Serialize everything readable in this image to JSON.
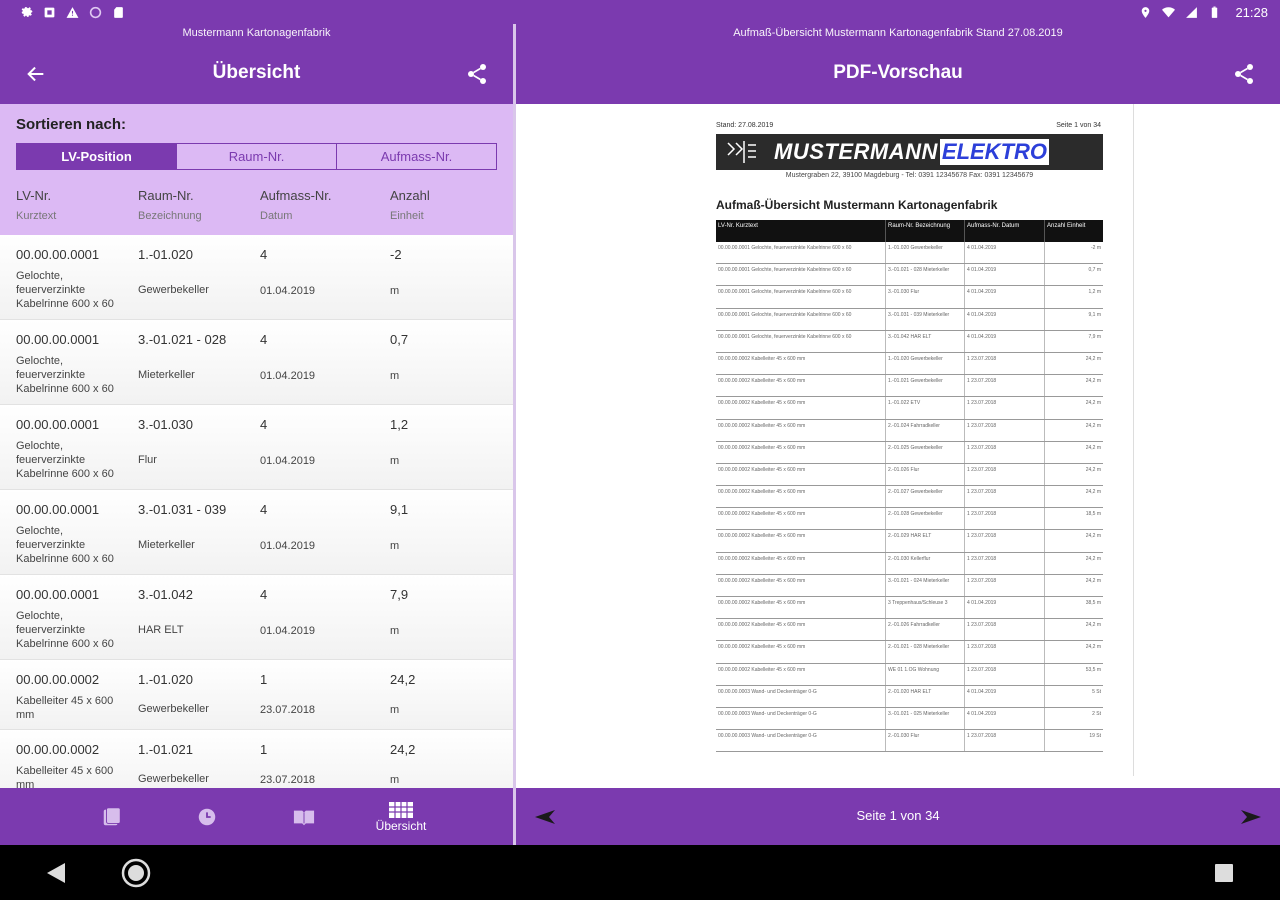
{
  "status_bar": {
    "time": "21:28",
    "left_icons": [
      "gear-icon",
      "app-icon",
      "warning-icon",
      "circle-icon",
      "sd-card-icon"
    ],
    "right_icons": [
      "location-icon",
      "wifi-icon",
      "signal-icon",
      "battery-icon"
    ]
  },
  "left_pane": {
    "subtitle": "Mustermann Kartonagenfabrik",
    "title": "Übersicht",
    "sort": {
      "label": "Sortieren nach:",
      "options": [
        {
          "label": "LV-Position",
          "active": true
        },
        {
          "label": "Raum-Nr.",
          "active": false
        },
        {
          "label": "Aufmass-Nr.",
          "active": false
        }
      ]
    },
    "columns": {
      "c1_main": "LV-Nr.",
      "c1_sub": "Kurztext",
      "c2_main": "Raum-Nr.",
      "c2_sub": "Bezeichnung",
      "c3_main": "Aufmass-Nr.",
      "c3_sub": "Datum",
      "c4_main": "Anzahl",
      "c4_sub": "Einheit"
    },
    "rows": [
      {
        "lv": "00.00.00.0001",
        "text": [
          "Gelochte,",
          "feuerverzinkte",
          "Kabelrinne 600 x 60"
        ],
        "raum": "1.-01.020",
        "bez": "Gewerbekeller",
        "aufmass": "4",
        "datum": "01.04.2019",
        "anzahl": "-2",
        "einheit": "m"
      },
      {
        "lv": "00.00.00.0001",
        "text": [
          "Gelochte,",
          "feuerverzinkte",
          "Kabelrinne 600 x 60"
        ],
        "raum": "3.-01.021 - 028",
        "bez": "Mieterkeller",
        "aufmass": "4",
        "datum": "01.04.2019",
        "anzahl": "0,7",
        "einheit": "m"
      },
      {
        "lv": "00.00.00.0001",
        "text": [
          "Gelochte,",
          "feuerverzinkte",
          "Kabelrinne 600 x 60"
        ],
        "raum": "3.-01.030",
        "bez": "Flur",
        "aufmass": "4",
        "datum": "01.04.2019",
        "anzahl": "1,2",
        "einheit": "m"
      },
      {
        "lv": "00.00.00.0001",
        "text": [
          "Gelochte,",
          "feuerverzinkte",
          "Kabelrinne 600 x 60"
        ],
        "raum": "3.-01.031 - 039",
        "bez": "Mieterkeller",
        "aufmass": "4",
        "datum": "01.04.2019",
        "anzahl": "9,1",
        "einheit": "m"
      },
      {
        "lv": "00.00.00.0001",
        "text": [
          "Gelochte,",
          "feuerverzinkte",
          "Kabelrinne 600 x 60"
        ],
        "raum": "3.-01.042",
        "bez": "HAR ELT",
        "aufmass": "4",
        "datum": "01.04.2019",
        "anzahl": "7,9",
        "einheit": "m"
      },
      {
        "lv": "00.00.00.0002",
        "text": [
          "Kabelleiter 45 x 600",
          "mm"
        ],
        "raum": "1.-01.020",
        "bez": "Gewerbekeller",
        "aufmass": "1",
        "datum": "23.07.2018",
        "anzahl": "24,2",
        "einheit": "m"
      },
      {
        "lv": "00.00.00.0002",
        "text": [
          "Kabelleiter 45 x 600",
          "mm"
        ],
        "raum": "1.-01.021",
        "bez": "Gewerbekeller",
        "aufmass": "1",
        "datum": "23.07.2018",
        "anzahl": "24,2",
        "einheit": "m"
      }
    ],
    "bottom_nav": [
      {
        "icon": "documents-icon",
        "label": ""
      },
      {
        "icon": "clock-icon",
        "label": ""
      },
      {
        "icon": "book-icon",
        "label": ""
      },
      {
        "icon": "grid-icon",
        "label": "Übersicht"
      }
    ]
  },
  "right_pane": {
    "subtitle": "Aufmaß-Übersicht Mustermann Kartonagenfabrik Stand 27.08.2019",
    "title": "PDF-Vorschau",
    "pdf": {
      "stand": "Stand: 27.08.2019",
      "page": "Seite 1 von 34",
      "logo_white": "MUSTERMANN",
      "logo_blue": "ELEKTRO",
      "address": "Mustergraben 22, 39100 Magdeburg - Tel: 0391 12345678 Fax: 0391 12345679",
      "heading": "Aufmaß-Übersicht Mustermann Kartonagenfabrik",
      "headers": [
        "LV-Nr. Kurztext",
        "Raum-Nr. Bezeichnung",
        "Aufmass-Nr. Datum",
        "Anzahl Einheit"
      ],
      "rows": [
        [
          "00.00.00.0001 Gelochte, feuerverzinkte Kabelrinne 600 x 60",
          "1.-01.020 Gewerbekeller",
          "4 01.04.2019",
          "-2 m"
        ],
        [
          "00.00.00.0001 Gelochte, feuerverzinkte Kabelrinne 600 x 60",
          "3.-01.021 - 028 Mieterkeller",
          "4 01.04.2019",
          "0,7 m"
        ],
        [
          "00.00.00.0001 Gelochte, feuerverzinkte Kabelrinne 600 x 60",
          "3.-01.030 Flur",
          "4 01.04.2019",
          "1,2 m"
        ],
        [
          "00.00.00.0001 Gelochte, feuerverzinkte Kabelrinne 600 x 60",
          "3.-01.031 - 039 Mieterkeller",
          "4 01.04.2019",
          "9,1 m"
        ],
        [
          "00.00.00.0001 Gelochte, feuerverzinkte Kabelrinne 600 x 60",
          "3.-01.042 HAR ELT",
          "4 01.04.2019",
          "7,9 m"
        ],
        [
          "00.00.00.0002 Kabelleiter 45 x 600 mm",
          "1.-01.020 Gewerbekeller",
          "1 23.07.2018",
          "24,2 m"
        ],
        [
          "00.00.00.0002 Kabelleiter 45 x 600 mm",
          "1.-01.021 Gewerbekeller",
          "1 23.07.2018",
          "24,2 m"
        ],
        [
          "00.00.00.0002 Kabelleiter 45 x 600 mm",
          "1.-01.022 ETV",
          "1 23.07.2018",
          "24,2 m"
        ],
        [
          "00.00.00.0002 Kabelleiter 45 x 600 mm",
          "2.-01.024 Fahrradkeller",
          "1 23.07.2018",
          "24,2 m"
        ],
        [
          "00.00.00.0002 Kabelleiter 45 x 600 mm",
          "2.-01.025 Gewerbekeller",
          "1 23.07.2018",
          "24,2 m"
        ],
        [
          "00.00.00.0002 Kabelleiter 45 x 600 mm",
          "2.-01.026 Flur",
          "1 23.07.2018",
          "24,2 m"
        ],
        [
          "00.00.00.0002 Kabelleiter 45 x 600 mm",
          "2.-01.027 Gewerbekeller",
          "1 23.07.2018",
          "24,2 m"
        ],
        [
          "00.00.00.0002 Kabelleiter 45 x 600 mm",
          "2.-01.028 Gewerbekeller",
          "1 23.07.2018",
          "18,5 m"
        ],
        [
          "00.00.00.0002 Kabelleiter 45 x 600 mm",
          "2.-01.029 HAR ELT",
          "1 23.07.2018",
          "24,2 m"
        ],
        [
          "00.00.00.0002 Kabelleiter 45 x 600 mm",
          "2.-01.030 Kellerflur",
          "1 23.07.2018",
          "24,2 m"
        ],
        [
          "00.00.00.0002 Kabelleiter 45 x 600 mm",
          "3.-01.021 - 024 Mieterkeller",
          "1 23.07.2018",
          "24,2 m"
        ],
        [
          "00.00.00.0002 Kabelleiter 45 x 600 mm",
          "3 Treppenhaus/Schleuse 3",
          "4 01.04.2019",
          "38,5 m"
        ],
        [
          "00.00.00.0002 Kabelleiter 45 x 600 mm",
          "2.-01.026 Fahrradkeller",
          "1 23.07.2018",
          "24,2 m"
        ],
        [
          "00.00.00.0002 Kabelleiter 45 x 600 mm",
          "2.-01.021 - 028 Mieterkeller",
          "1 23.07.2018",
          "24,2 m"
        ],
        [
          "00.00.00.0002 Kabelleiter 45 x 600 mm",
          "WE 01 1.OG Wohnung",
          "1 23.07.2018",
          "53,5 m"
        ],
        [
          "00.00.00.0003 Wand- und Deckenträger 0-G",
          "2.-01.020 HAR ELT",
          "4 01.04.2019",
          "5 St"
        ],
        [
          "00.00.00.0003 Wand- und Deckenträger 0-G",
          "3.-01.021 - 025 Mieterkeller",
          "4 01.04.2019",
          "2 St"
        ],
        [
          "00.00.00.0003 Wand- und Deckenträger 0-G",
          "2.-01.030 Flur",
          "1 23.07.2018",
          "19 St"
        ]
      ]
    },
    "pager": {
      "label": "Seite 1 von 34"
    }
  },
  "nav": [
    "back-icon",
    "home-icon",
    "recents-icon"
  ]
}
